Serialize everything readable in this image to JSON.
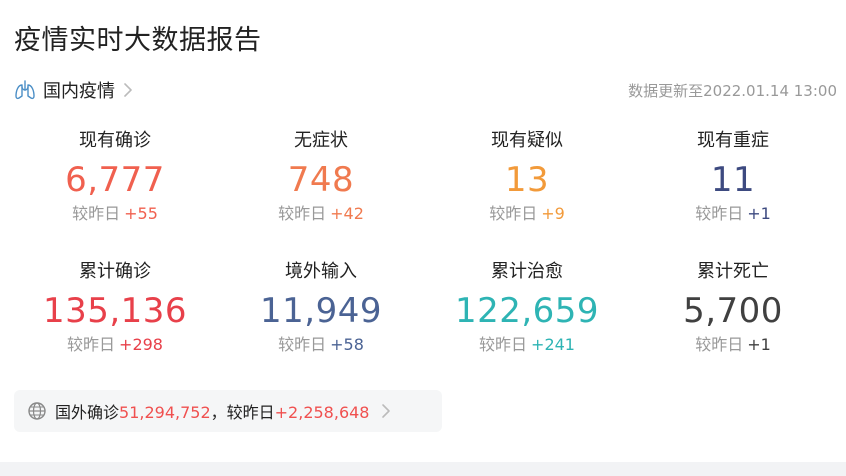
{
  "header": {
    "title": "疫情实时大数据报告"
  },
  "domestic": {
    "label": "国内疫情",
    "icon": "lungs-icon",
    "update_text": "数据更新至2022.01.14 13:00"
  },
  "stats_row1": [
    {
      "label": "现有确诊",
      "value": "6,777",
      "delta_label": "较昨日",
      "delta": "+55",
      "color": "#f0604f"
    },
    {
      "label": "无症状",
      "value": "748",
      "delta_label": "较昨日",
      "delta": "+42",
      "color": "#f07a4f"
    },
    {
      "label": "现有疑似",
      "value": "13",
      "delta_label": "较昨日",
      "delta": "+9",
      "color": "#f29a3a"
    },
    {
      "label": "现有重症",
      "value": "11",
      "delta_label": "较昨日",
      "delta": "+1",
      "color": "#3d4a80"
    }
  ],
  "stats_row2": [
    {
      "label": "累计确诊",
      "value": "135,136",
      "delta_label": "较昨日",
      "delta": "+298",
      "color": "#e8404a"
    },
    {
      "label": "境外输入",
      "value": "11,949",
      "delta_label": "较昨日",
      "delta": "+58",
      "color": "#4b6394"
    },
    {
      "label": "累计治愈",
      "value": "122,659",
      "delta_label": "较昨日",
      "delta": "+241",
      "color": "#2eb4b4"
    },
    {
      "label": "累计死亡",
      "value": "5,700",
      "delta_label": "较昨日",
      "delta": "+1",
      "color": "#404040"
    }
  ],
  "foreign": {
    "icon": "globe-icon",
    "prefix": "国外确诊",
    "value": "51,294,752",
    "separator": "，较昨日",
    "delta": "+2,258,648"
  }
}
